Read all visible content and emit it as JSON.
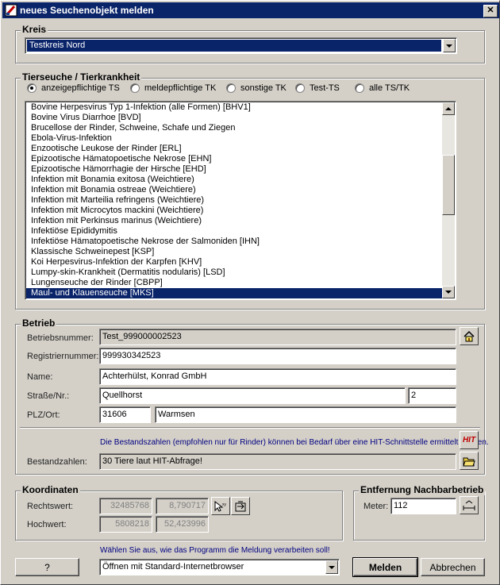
{
  "window": {
    "title": "neues Seuchenobjekt melden",
    "close": "✕"
  },
  "kreis": {
    "label": "Kreis",
    "value": "Testkreis Nord"
  },
  "tierseuche": {
    "label": "Tierseuche / Tierkrankheit",
    "radios": [
      {
        "label": "anzeigepflichtige TS",
        "checked": true
      },
      {
        "label": "meldepflichtige TK",
        "checked": false
      },
      {
        "label": "sonstige TK",
        "checked": false
      },
      {
        "label": "Test-TS",
        "checked": false
      },
      {
        "label": "alle TS/TK",
        "checked": false
      }
    ],
    "items": [
      "Bovine Herpesvirus Typ 1-Infektion (alle Formen) [BHV1]",
      "Bovine Virus Diarrhoe [BVD]",
      "Brucellose der Rinder, Schweine, Schafe und Ziegen",
      "Ebola-Virus-Infektion",
      "Enzootische Leukose der Rinder [ERL]",
      "Epizootische Hämatopoetische Nekrose [EHN]",
      "Epizootische Hämorrhagie der Hirsche [EHD]",
      "Infektion mit Bonamia exitosa (Weichtiere)",
      "Infektion mit Bonamia ostreae (Weichtiere)",
      "Infektion mit Marteilia refringens (Weichtiere)",
      "Infektion mit Microcytos mackini (Weichtiere)",
      "Infektion mit Perkinsus marinus (Weichtiere)",
      "Infektiöse Epididymitis",
      "Infektiöse Hämatopoetische Nekrose der Salmoniden [IHN]",
      "Klassische Schweinepest [KSP]",
      "Koi Herpesvirus-Infektion der Karpfen [KHV]",
      "Lumpy-skin-Krankheit (Dermatitis nodularis) [LSD]",
      "Lungenseuche der Rinder [CBPP]",
      "Maul- und Klauenseuche [MKS]"
    ],
    "selected_index": 18
  },
  "betrieb": {
    "label": "Betrieb",
    "betriebsnummer_label": "Betriebsnummer:",
    "betriebsnummer": "Test_999000002523",
    "registriernummer_label": "Registriernummer:",
    "registriernummer": "999930342523",
    "name_label": "Name:",
    "name": "Achterhülst, Konrad GmbH",
    "strasse_label": "Straße/Nr.:",
    "strasse": "Quellhorst",
    "nr": "2",
    "plzort_label": "PLZ/Ort:",
    "plz": "31606",
    "ort": "Warmsen",
    "bestand_hint": "Die Bestandszahlen (empfohlen nur für Rinder) können bei Bedarf über eine HIT-Schnittstelle ermittelt werden.",
    "bestand_label": "Bestandzahlen:",
    "bestand": "30 Tiere laut HIT-Abfrage!",
    "hit_label": "HIT"
  },
  "koordinaten": {
    "label": "Koordinaten",
    "rechtswert_label": "Rechtswert:",
    "rechtswert_gk": "32485768",
    "rechtswert_geo": "8,790717",
    "hochwert_label": "Hochwert:",
    "hochwert_gk": "5808218",
    "hochwert_geo": "52,423996"
  },
  "entfernung": {
    "label": "Entfernung Nachbarbetrieb",
    "meter_label": "Meter:",
    "meter": "112"
  },
  "footer": {
    "hint": "Wählen Sie aus, wie das Programm die Meldung verarbeiten soll!",
    "help_label": "?",
    "mode": "Öffnen mit Standard-Internetbrowser",
    "melden_label": "Melden",
    "abbrechen_label": "Abbrechen"
  },
  "colors": {
    "title_bg": "#0a246a",
    "selection": "#0a246a",
    "hint_text": "#000080",
    "face": "#d4d0c8"
  }
}
